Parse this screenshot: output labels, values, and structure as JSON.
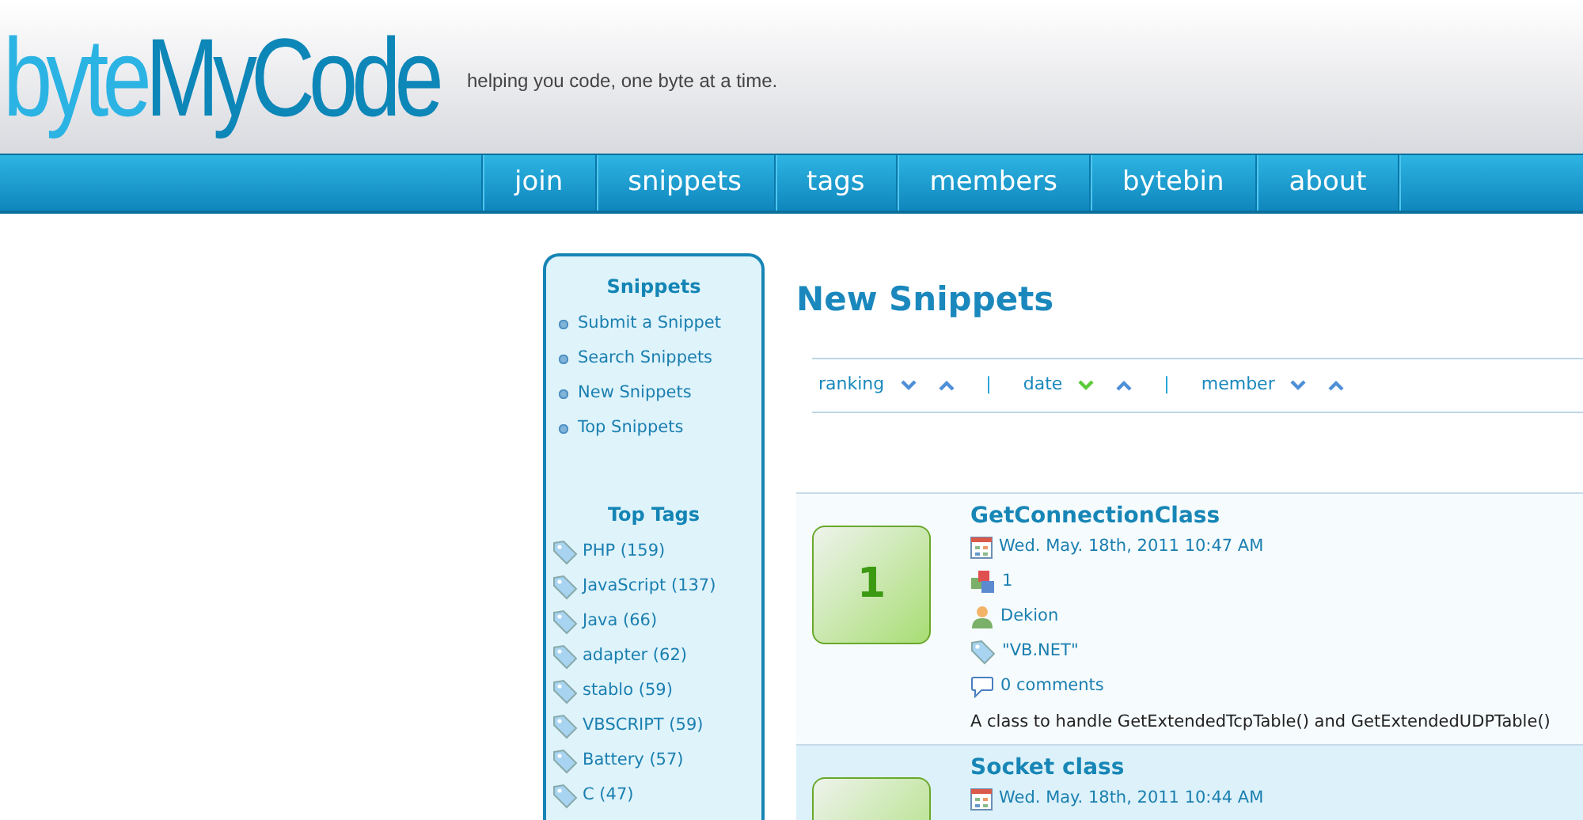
{
  "header": {
    "logo": [
      {
        "text": "byte",
        "color": "#2bb3e3"
      },
      {
        "text": "MyCode",
        "color": "#0d86b8"
      }
    ],
    "tagline": "helping you code, one byte at a time."
  },
  "nav": [
    {
      "label": "join"
    },
    {
      "label": "snippets"
    },
    {
      "label": "tags"
    },
    {
      "label": "members"
    },
    {
      "label": "bytebin"
    },
    {
      "label": "about"
    }
  ],
  "sidebar": {
    "snippets_title": "Snippets",
    "links": [
      "Submit a Snippet",
      "Search Snippets",
      "New Snippets",
      "Top Snippets"
    ],
    "tags_title": "Top Tags",
    "tags": [
      "PHP (159)",
      "JavaScript (137)",
      "Java (66)",
      "adapter (62)",
      "stablo (59)",
      "VBSCRIPT (59)",
      "Battery (57)",
      "C (47)"
    ]
  },
  "main": {
    "title": "New Snippets",
    "sort": [
      {
        "label": "ranking",
        "down_selected": false,
        "up_selected": false
      },
      {
        "label": "date",
        "down_selected": true,
        "up_selected": false
      },
      {
        "label": "member",
        "down_selected": false,
        "up_selected": false
      }
    ],
    "separator": "|",
    "snippets": [
      {
        "score": "1",
        "title": "GetConnectionClass",
        "highlighted": false,
        "meta": [
          {
            "kind": "date",
            "text": "Wed. May. 18th, 2011 10:47 AM"
          },
          {
            "kind": "votes",
            "text": "1"
          },
          {
            "kind": "author",
            "text": "Dekion"
          },
          {
            "kind": "tag",
            "text": "\"VB.NET\""
          },
          {
            "kind": "comments",
            "text": "0 comments"
          }
        ],
        "description": "A class to handle GetExtendedTcpTable() and GetExtendedUDPTable()"
      },
      {
        "title": "Socket class",
        "highlighted": true,
        "meta": [
          {
            "kind": "date",
            "text": "Wed. May. 18th, 2011 10:44 AM"
          }
        ]
      }
    ]
  }
}
